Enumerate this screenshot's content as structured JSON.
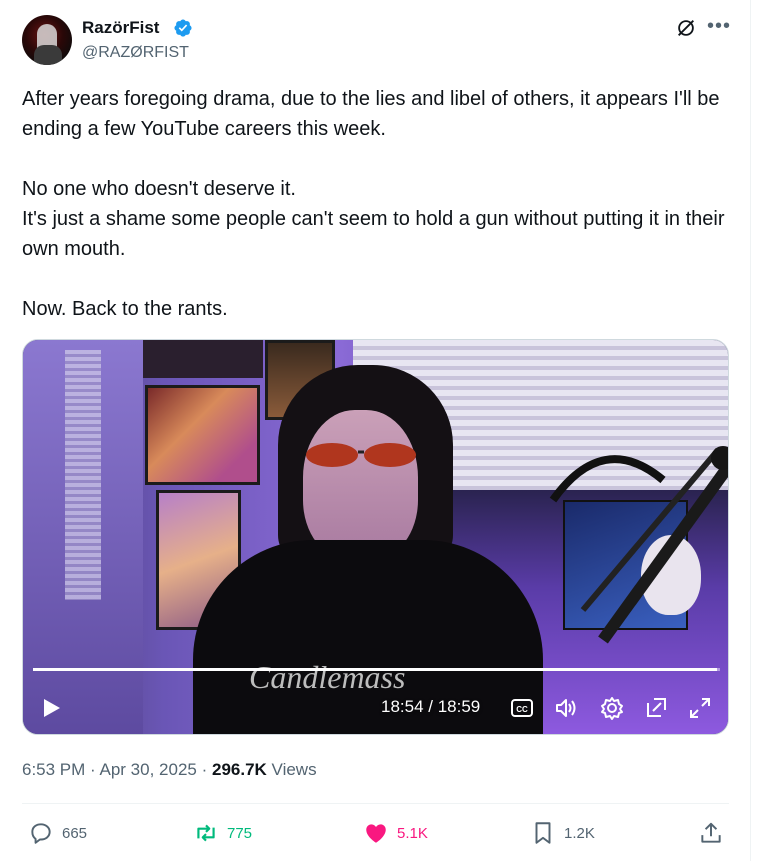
{
  "author": {
    "display_name": "RazörFist",
    "handle": "@RAZØRFIST",
    "verified": true
  },
  "tweet": {
    "paragraphs": [
      "After years foregoing drama, due to the lies and libel of others, it appears I'll be ending a few YouTube careers this week.",
      "No one who doesn't deserve it.",
      "It's just a shame some people can't seem to hold a gun without putting it in their own mouth.",
      "Now. Back to the rants."
    ]
  },
  "video": {
    "time_display": "18:54 / 18:59",
    "progress_fraction": 0.9956,
    "overlay_text": "Candlemass"
  },
  "meta": {
    "time": "6:53 PM",
    "date": "Apr 30, 2025",
    "views_count": "296.7K",
    "views_label": "Views"
  },
  "actions": {
    "replies": "665",
    "reposts": "775",
    "likes": "5.1K",
    "bookmarks": "1.2K"
  },
  "colors": {
    "verified": "#1d9bf0",
    "repost": "#00ba7c",
    "like": "#f91880",
    "muted": "#536471"
  },
  "icons": [
    "verified-badge-icon",
    "grok-icon",
    "more-icon",
    "play-icon",
    "captions-icon",
    "volume-icon",
    "settings-icon",
    "pip-icon",
    "fullscreen-icon",
    "reply-icon",
    "repost-icon",
    "like-icon",
    "bookmark-icon",
    "share-icon"
  ]
}
